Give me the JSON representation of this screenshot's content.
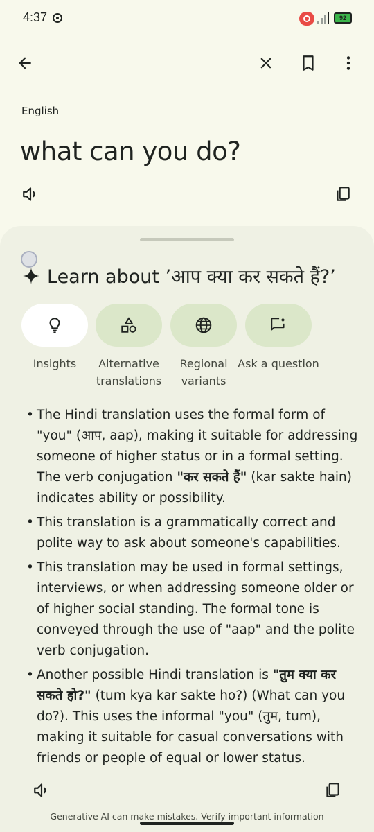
{
  "status_bar": {
    "time": "4:37",
    "battery": "92"
  },
  "source": {
    "language": "English",
    "text": "what can you do?"
  },
  "learn": {
    "title": "Learn about ’आप क्या कर सकते हैं?’"
  },
  "chips": [
    {
      "label": "Insights",
      "icon": "lightbulb-icon"
    },
    {
      "label": "Alternative translations",
      "icon": "shapes-icon"
    },
    {
      "label": "Regional variants",
      "icon": "globe-icon"
    },
    {
      "label": "Ask a question",
      "icon": "chat-sparkle-icon"
    }
  ],
  "insights": [
    {
      "pre": "The Hindi translation uses the formal form of \"you\" (आप, aap), making it suitable for addressing someone of higher status or in a formal setting. The verb conjugation ",
      "bold": "\"कर सकते हैं\"",
      "post": " (kar sakte hain) indicates ability or possibility."
    },
    {
      "pre": "This translation is a grammatically correct and polite way to ask about someone's capabilities.",
      "bold": "",
      "post": ""
    },
    {
      "pre": "This translation may be used in formal settings, interviews, or when addressing someone older or of higher social standing.  The formal tone is conveyed through the use of \"aap\" and the polite verb conjugation.",
      "bold": "",
      "post": ""
    },
    {
      "pre": "Another possible Hindi translation is ",
      "bold": "\"तुम क्या कर सकते हो?\"",
      "post": " (tum kya kar sakte ho?) (What can you do?). This uses the informal \"you\" (तुम, tum), making it suitable for casual conversations with friends or people of equal or lower status."
    }
  ],
  "disclaimer": "Generative AI can make mistakes. Verify important information",
  "colors": {
    "background": "#f8f9ec",
    "sheet": "#eff1e4",
    "chip": "#dbe7c9",
    "chip_active": "#ffffff"
  }
}
